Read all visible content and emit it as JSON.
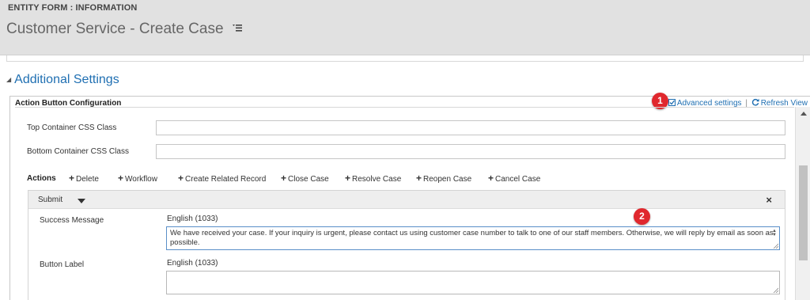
{
  "header": {
    "entity_label": "ENTITY FORM : INFORMATION",
    "form_title": "Customer Service - Create Case"
  },
  "section": {
    "heading": "Additional Settings"
  },
  "action_config": {
    "title": "Action Button Configuration",
    "advanced_settings": "Advanced settings",
    "separator": "|",
    "refresh_view": "Refresh View",
    "badge_1": "1",
    "badge_2": "2"
  },
  "fields": {
    "top_container_label": "Top Container CSS Class",
    "top_container_value": "",
    "bottom_container_label": "Bottom Container CSS Class",
    "bottom_container_value": ""
  },
  "actions": {
    "label": "Actions",
    "buttons": [
      "Delete",
      "Workflow",
      "Create Related Record",
      "Close Case",
      "Resolve Case",
      "Reopen Case",
      "Cancel Case"
    ]
  },
  "submit": {
    "label": "Submit",
    "close_glyph": "×",
    "success_message_label": "Success Message",
    "success_message_lang": "English (1033)",
    "success_message_value": "We have received your case. If your inquiry is urgent, please contact us using customer case number to talk to one of our staff members. Otherwise, we will reply by email as soon as possible.",
    "button_label_label": "Button Label",
    "button_label_lang": "English (1033)",
    "button_label_value": ""
  },
  "colors": {
    "link": "#1f6fb2",
    "badge": "#e0282e",
    "header_bg": "#e1e1e1"
  }
}
